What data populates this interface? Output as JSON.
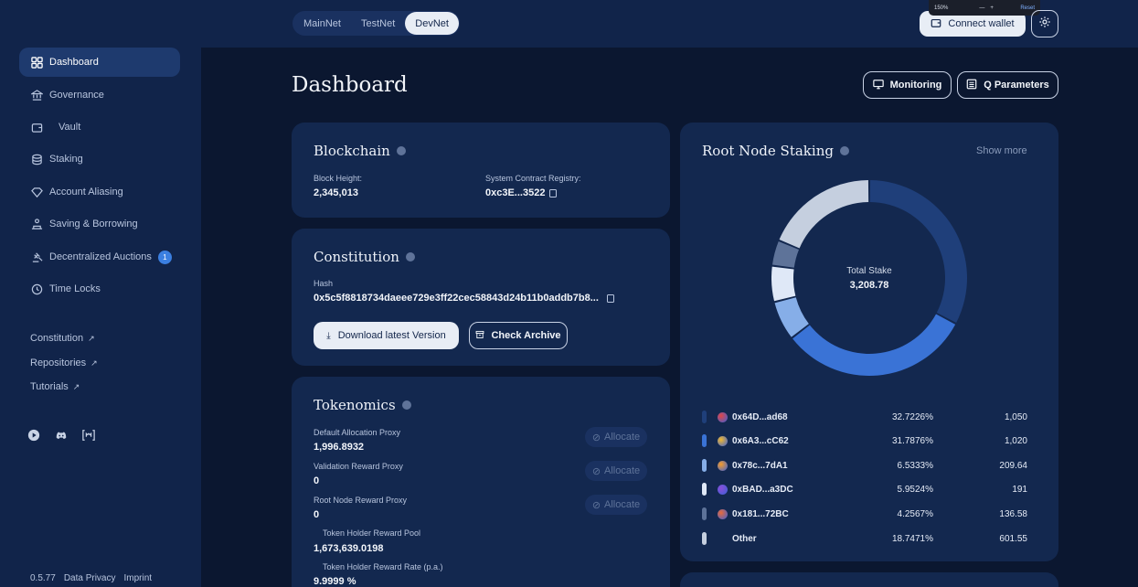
{
  "network": {
    "options": [
      "MainNet",
      "TestNet",
      "DevNet"
    ],
    "active": "DevNet"
  },
  "topbar": {
    "connect_label": "Connect wallet",
    "zoom_level": "150%",
    "zoom_minus": "—",
    "zoom_plus": "+",
    "zoom_reset": "Reset"
  },
  "sidebar": {
    "items": [
      {
        "label": "Dashboard",
        "icon": "grid-icon",
        "active": true
      },
      {
        "label": "Governance",
        "icon": "bank-icon"
      },
      {
        "label": "Vault",
        "icon": "wallet-icon"
      },
      {
        "label": "Staking",
        "icon": "coins-icon"
      },
      {
        "label": "Account Aliasing",
        "icon": "diamond-icon"
      },
      {
        "label": "Saving & Borrowing",
        "icon": "piggy-icon"
      },
      {
        "label": "Decentralized Auctions",
        "icon": "gavel-icon",
        "badge": "1"
      },
      {
        "label": "Time Locks",
        "icon": "clock-icon"
      }
    ],
    "links": [
      "Constitution",
      "Repositories",
      "Tutorials"
    ],
    "footer": {
      "version": "0.5.77",
      "privacy": "Data Privacy",
      "imprint": "Imprint"
    }
  },
  "page": {
    "title": "Dashboard",
    "monitoring_label": "Monitoring",
    "q_parameters_label": "Q Parameters"
  },
  "blockchain": {
    "title": "Blockchain",
    "block_height_label": "Block Height:",
    "block_height": "2,345,013",
    "registry_label": "System Contract Registry:",
    "registry": "0xc3E...3522"
  },
  "constitution": {
    "title": "Constitution",
    "hash_label": "Hash",
    "hash": "0x5c5f8818734daeee729e3ff22cec58843d24b11b0addb7b8...",
    "download_label": "Download latest Version",
    "archive_label": "Check Archive"
  },
  "tokenomics": {
    "title": "Tokenomics",
    "allocate_label": "Allocate",
    "rows": [
      {
        "label": "Default Allocation Proxy",
        "value": "1,996.8932"
      },
      {
        "label": "Validation Reward Proxy",
        "value": "0"
      },
      {
        "label": "Root Node Reward Proxy",
        "value": "0"
      },
      {
        "label": "Token Holder Reward Pool",
        "value": "1,673,639.0198"
      },
      {
        "label": "Token Holder Reward Rate (p.a.)",
        "value": "9.9999 %"
      }
    ]
  },
  "staking": {
    "title": "Root Node Staking",
    "show_more": "Show more",
    "total_label": "Total Stake",
    "total_value": "3,208.78",
    "rows": [
      {
        "address": "0x64D...ad68",
        "percent": "32.7226%",
        "amount": "1,050",
        "share": 32.7226,
        "color": "#1f3f7a",
        "avatar": "#e04646"
      },
      {
        "address": "0x6A3...cC62",
        "percent": "31.7876%",
        "amount": "1,020",
        "share": 31.7876,
        "color": "#3a73d6",
        "avatar": "#f0b830"
      },
      {
        "address": "0x78c...7dA1",
        "percent": "6.5333%",
        "amount": "209.64",
        "share": 6.5333,
        "color": "#86aee8",
        "avatar": "#f59c2a"
      },
      {
        "address": "0xBAD...a3DC",
        "percent": "5.9524%",
        "amount": "191",
        "share": 5.9524,
        "color": "#dfe8f7",
        "avatar": "#8a4fd8"
      },
      {
        "address": "0x181...72BC",
        "percent": "4.2567%",
        "amount": "136.58",
        "share": 4.2567,
        "color": "#5e7399",
        "avatar": "#e86a3a"
      },
      {
        "address": "Other",
        "percent": "18.7471%",
        "amount": "601.55",
        "share": 18.7471,
        "color": "#c5cfdf",
        "avatar": ""
      }
    ]
  }
}
